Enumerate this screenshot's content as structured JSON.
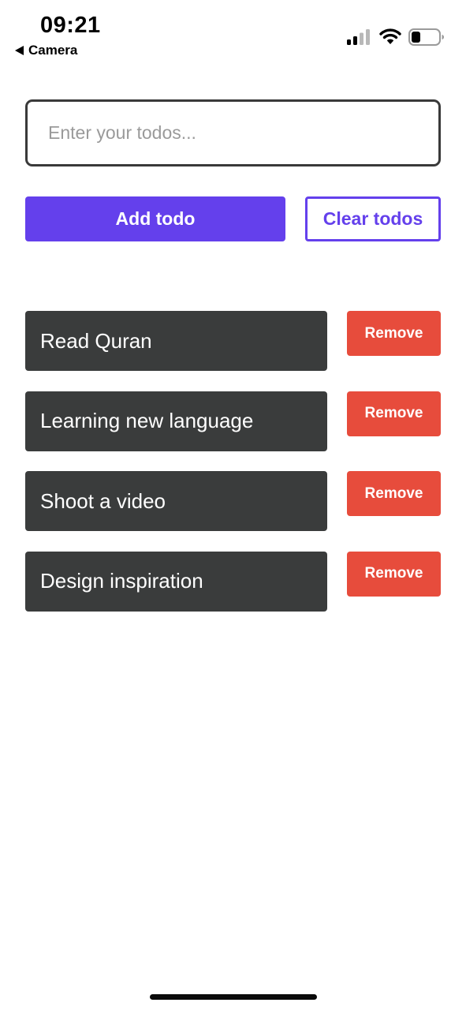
{
  "status_bar": {
    "time": "09:21",
    "back_label": "Camera",
    "icons": [
      "signal-icon",
      "wifi-icon",
      "battery-icon"
    ]
  },
  "input": {
    "placeholder": "Enter your todos...",
    "value": ""
  },
  "actions": {
    "add_label": "Add todo",
    "clear_label": "Clear todos"
  },
  "todos": [
    {
      "text": "Read Quran",
      "remove_label": "Remove"
    },
    {
      "text": "Learning new language",
      "remove_label": "Remove"
    },
    {
      "text": "Shoot a video",
      "remove_label": "Remove"
    },
    {
      "text": "Design inspiration",
      "remove_label": "Remove"
    }
  ],
  "colors": {
    "accent": "#6440ec",
    "todo_bg": "#3a3c3c",
    "remove": "#e74c3c",
    "input_border": "#3a3a3a"
  }
}
